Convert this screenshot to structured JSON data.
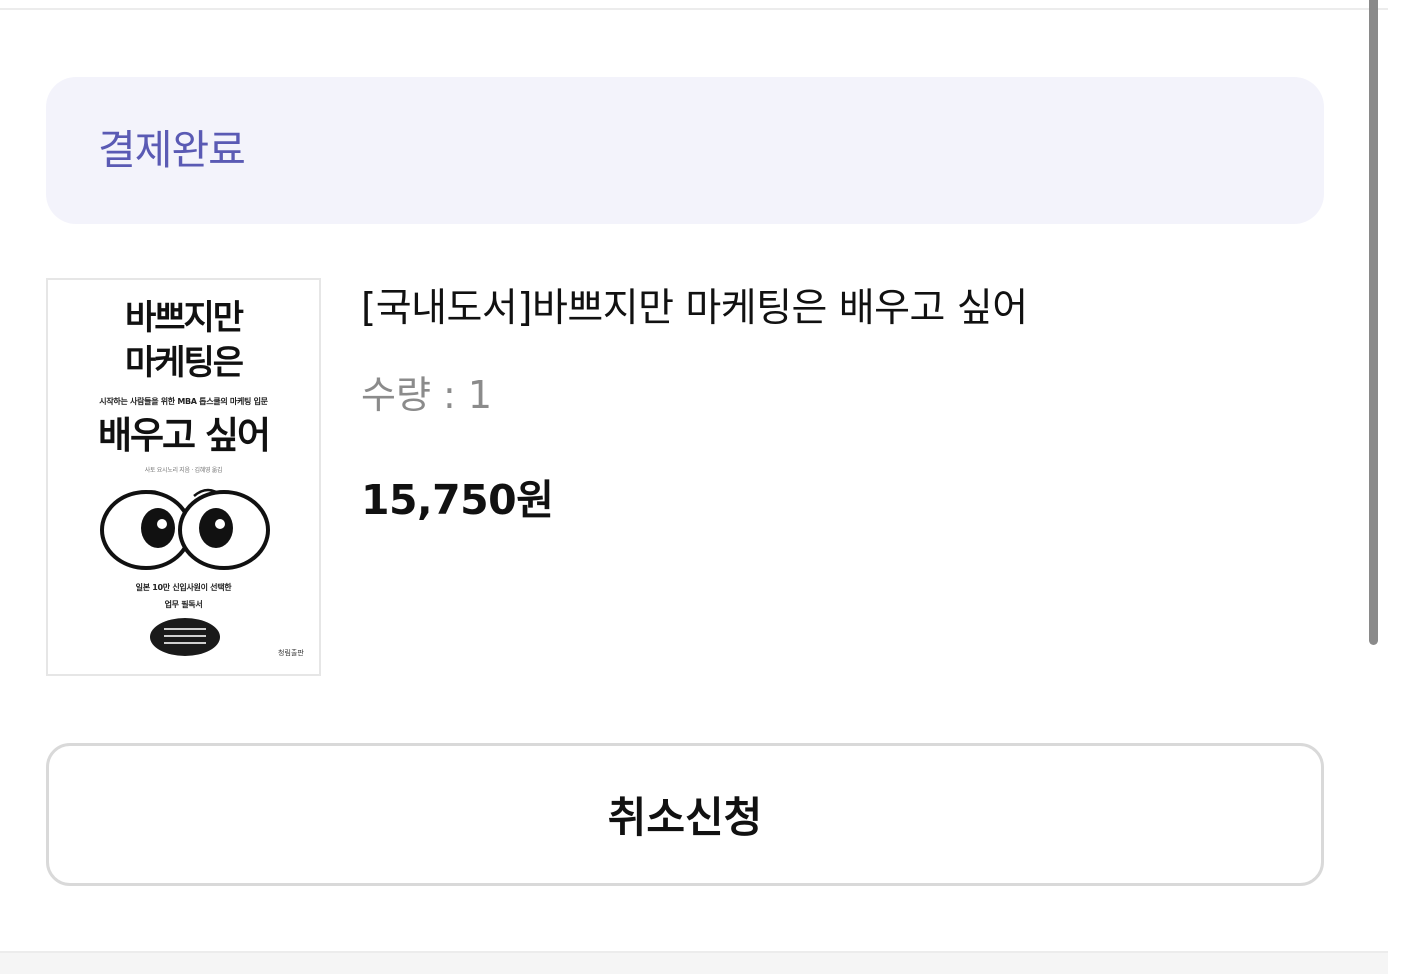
{
  "status": {
    "label": "결제완료"
  },
  "product": {
    "title": "[국내도서]바쁘지만 마케팅은 배우고 싶어",
    "quantity": "수량 : 1",
    "price": "15,750원",
    "cover": {
      "title_line1": "바쁘지만",
      "title_line2": "마케팅은",
      "subtitle": "시작하는 사람들을 위한 MBA 톱스쿨의 마케팅 입문",
      "title_line3": "배우고 싶어",
      "author": "사토 요시노리 지음 · 김혜영 옮김",
      "tagline1": "일본 10만 신입사원이 선택한",
      "tagline2": "업무 필독서",
      "publisher": "청림출판"
    }
  },
  "actions": {
    "cancel_label": "취소신청"
  }
}
